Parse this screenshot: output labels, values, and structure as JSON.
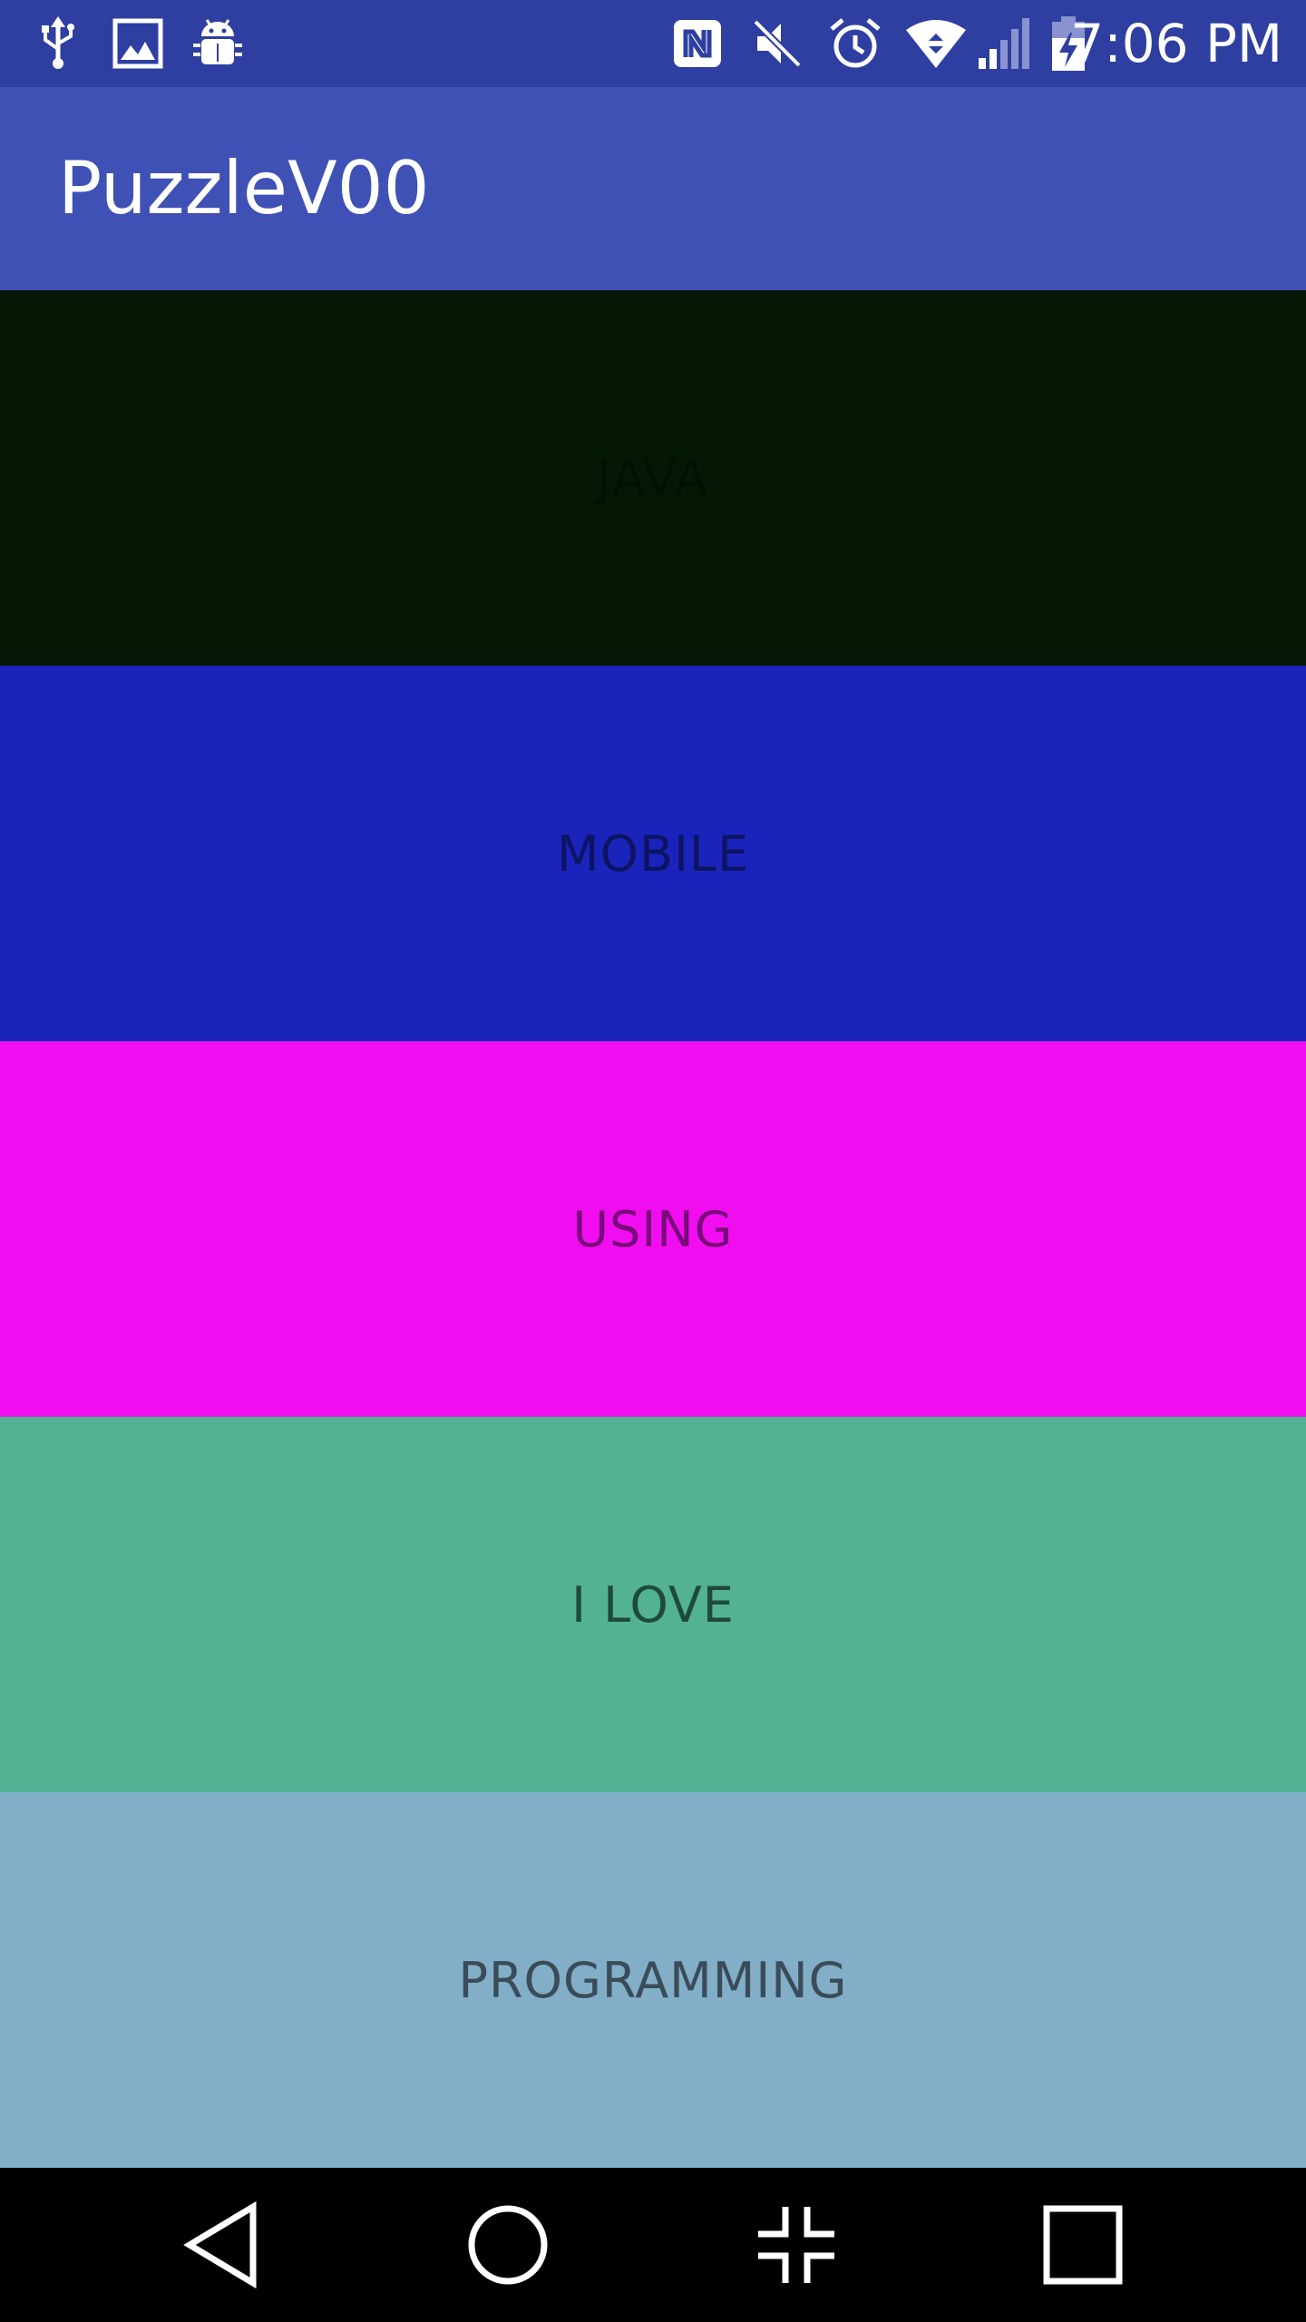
{
  "status_bar": {
    "time": "7:06 PM",
    "left_icons": [
      "usb-icon",
      "image-icon",
      "android-debug-icon"
    ],
    "right_icons": [
      "nfc-icon",
      "mute-icon",
      "alarm-icon",
      "wifi-icon",
      "signal-icon",
      "battery-charging-icon"
    ],
    "color": "#2e3fa1"
  },
  "app_bar": {
    "title": "PuzzleV00",
    "color": "#3f51b5"
  },
  "panels": [
    {
      "label": "JAVA",
      "background": "#051805",
      "text_color": "#031003"
    },
    {
      "label": "MOBILE",
      "background": "#1a24bb",
      "text_color": "#0d1462"
    },
    {
      "label": "USING",
      "background": "#f00ef0",
      "text_color": "#7a0a7a"
    },
    {
      "label": "I LOVE",
      "background": "#53b293",
      "text_color": "#1e4a3c"
    },
    {
      "label": "PROGRAMMING",
      "background": "#82aec8",
      "text_color": "#3a4c58"
    }
  ],
  "nav_bar": {
    "buttons": [
      "back-icon",
      "home-icon",
      "split-screen-icon",
      "recents-icon"
    ]
  }
}
